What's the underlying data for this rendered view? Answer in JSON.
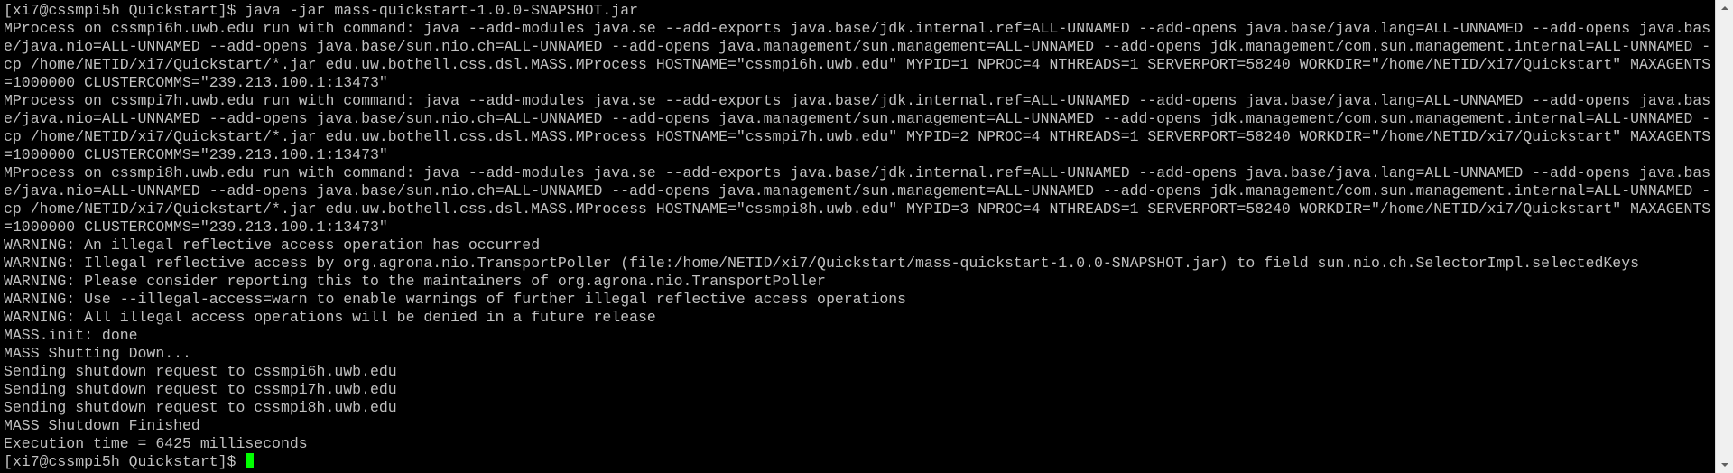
{
  "terminal": {
    "lines": [
      "[xi7@cssmpi5h Quickstart]$ java -jar mass-quickstart-1.0.0-SNAPSHOT.jar",
      "MProcess on cssmpi6h.uwb.edu run with command: java --add-modules java.se --add-exports java.base/jdk.internal.ref=ALL-UNNAMED --add-opens java.base/java.lang=ALL-UNNAMED --add-opens java.base/java.nio=ALL-UNNAMED --add-opens java.base/sun.nio.ch=ALL-UNNAMED --add-opens java.management/sun.management=ALL-UNNAMED --add-opens jdk.management/com.sun.management.internal=ALL-UNNAMED -cp /home/NETID/xi7/Quickstart/*.jar edu.uw.bothell.css.dsl.MASS.MProcess HOSTNAME=\"cssmpi6h.uwb.edu\" MYPID=1 NPROC=4 NTHREADS=1 SERVERPORT=58240 WORKDIR=\"/home/NETID/xi7/Quickstart\" MAXAGENTS=1000000 CLUSTERCOMMS=\"239.213.100.1:13473\"",
      "MProcess on cssmpi7h.uwb.edu run with command: java --add-modules java.se --add-exports java.base/jdk.internal.ref=ALL-UNNAMED --add-opens java.base/java.lang=ALL-UNNAMED --add-opens java.base/java.nio=ALL-UNNAMED --add-opens java.base/sun.nio.ch=ALL-UNNAMED --add-opens java.management/sun.management=ALL-UNNAMED --add-opens jdk.management/com.sun.management.internal=ALL-UNNAMED -cp /home/NETID/xi7/Quickstart/*.jar edu.uw.bothell.css.dsl.MASS.MProcess HOSTNAME=\"cssmpi7h.uwb.edu\" MYPID=2 NPROC=4 NTHREADS=1 SERVERPORT=58240 WORKDIR=\"/home/NETID/xi7/Quickstart\" MAXAGENTS=1000000 CLUSTERCOMMS=\"239.213.100.1:13473\"",
      "MProcess on cssmpi8h.uwb.edu run with command: java --add-modules java.se --add-exports java.base/jdk.internal.ref=ALL-UNNAMED --add-opens java.base/java.lang=ALL-UNNAMED --add-opens java.base/java.nio=ALL-UNNAMED --add-opens java.base/sun.nio.ch=ALL-UNNAMED --add-opens java.management/sun.management=ALL-UNNAMED --add-opens jdk.management/com.sun.management.internal=ALL-UNNAMED -cp /home/NETID/xi7/Quickstart/*.jar edu.uw.bothell.css.dsl.MASS.MProcess HOSTNAME=\"cssmpi8h.uwb.edu\" MYPID=3 NPROC=4 NTHREADS=1 SERVERPORT=58240 WORKDIR=\"/home/NETID/xi7/Quickstart\" MAXAGENTS=1000000 CLUSTERCOMMS=\"239.213.100.1:13473\"",
      "WARNING: An illegal reflective access operation has occurred",
      "WARNING: Illegal reflective access by org.agrona.nio.TransportPoller (file:/home/NETID/xi7/Quickstart/mass-quickstart-1.0.0-SNAPSHOT.jar) to field sun.nio.ch.SelectorImpl.selectedKeys",
      "WARNING: Please consider reporting this to the maintainers of org.agrona.nio.TransportPoller",
      "WARNING: Use --illegal-access=warn to enable warnings of further illegal reflective access operations",
      "WARNING: All illegal access operations will be denied in a future release",
      "MASS.init: done",
      "MASS Shutting Down...",
      "Sending shutdown request to cssmpi6h.uwb.edu",
      "Sending shutdown request to cssmpi7h.uwb.edu",
      "Sending shutdown request to cssmpi8h.uwb.edu",
      "MASS Shutdown Finished",
      "Execution time = 6425 milliseconds"
    ],
    "prompt": "[xi7@cssmpi5h Quickstart]$ ",
    "colors": {
      "background": "#000000",
      "text": "#c0c0c0",
      "cursor": "#00ff00"
    }
  },
  "scrollbar": {
    "position": 1.0
  }
}
